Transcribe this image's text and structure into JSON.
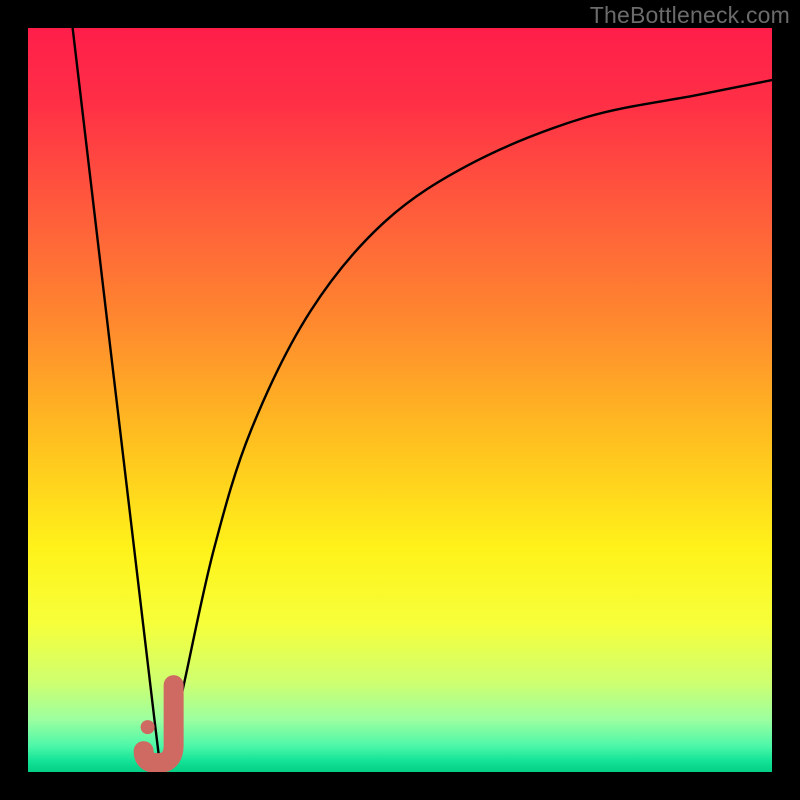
{
  "watermark": "TheBottleneck.com",
  "chart_data": {
    "type": "line",
    "title": "",
    "xlabel": "",
    "ylabel": "",
    "xlim": [
      0,
      100
    ],
    "ylim": [
      0,
      100
    ],
    "grid": false,
    "legend": false,
    "series": [
      {
        "name": "bottleneck-curve",
        "points": [
          {
            "x": 6,
            "y": 100
          },
          {
            "x": 17,
            "y": 7
          },
          {
            "x": 18,
            "y": 1
          },
          {
            "x": 19,
            "y": 3
          },
          {
            "x": 21,
            "y": 12
          },
          {
            "x": 25,
            "y": 30
          },
          {
            "x": 30,
            "y": 46
          },
          {
            "x": 38,
            "y": 62
          },
          {
            "x": 48,
            "y": 74
          },
          {
            "x": 60,
            "y": 82
          },
          {
            "x": 75,
            "y": 88
          },
          {
            "x": 90,
            "y": 91
          },
          {
            "x": 100,
            "y": 93
          }
        ]
      }
    ],
    "marker": {
      "name": "current-config",
      "shape": "check",
      "x": 18.5,
      "y": 2,
      "color": "#cf6a63"
    },
    "gradient_stops": [
      {
        "offset": 0.0,
        "color": "#ff1e4a"
      },
      {
        "offset": 0.1,
        "color": "#ff2f46"
      },
      {
        "offset": 0.24,
        "color": "#ff5a3c"
      },
      {
        "offset": 0.4,
        "color": "#ff8a2e"
      },
      {
        "offset": 0.56,
        "color": "#ffc21f"
      },
      {
        "offset": 0.7,
        "color": "#fff21a"
      },
      {
        "offset": 0.8,
        "color": "#f6ff3a"
      },
      {
        "offset": 0.88,
        "color": "#ceff70"
      },
      {
        "offset": 0.93,
        "color": "#9bffa0"
      },
      {
        "offset": 0.965,
        "color": "#4cf7a8"
      },
      {
        "offset": 0.985,
        "color": "#14e397"
      },
      {
        "offset": 1.0,
        "color": "#03ce85"
      }
    ]
  }
}
